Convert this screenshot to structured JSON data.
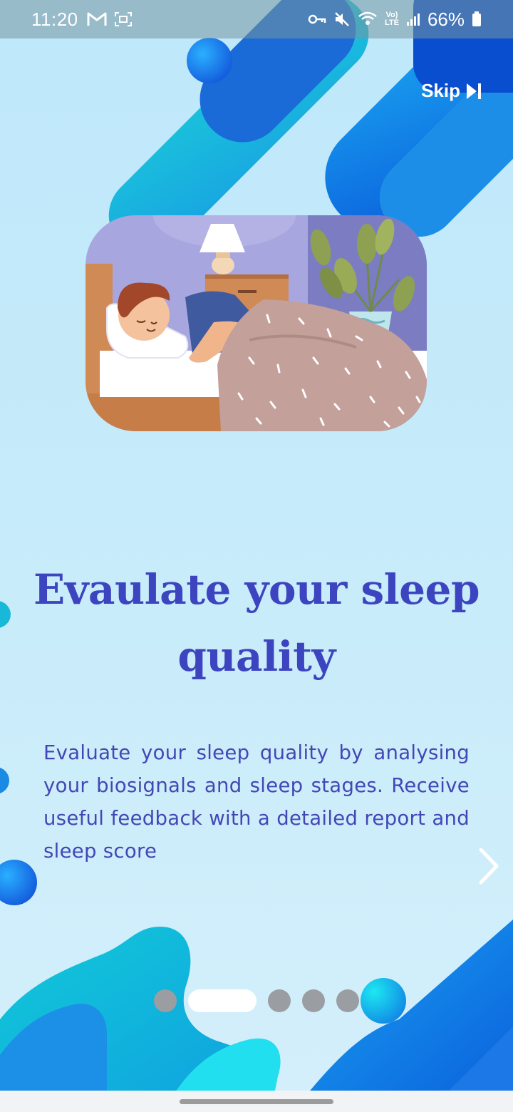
{
  "status_bar": {
    "time": "11:20",
    "battery_text": "66%",
    "left_icons": [
      "gmail-icon",
      "screen-capture-icon"
    ],
    "right_icons": [
      "vpn-key-icon",
      "mute-icon",
      "wifi-icon",
      "volte-icon",
      "signal-icon",
      "battery-icon"
    ],
    "volte_label": "Vo) LTE"
  },
  "onboarding": {
    "skip_label": "Skip",
    "title": "Evaulate your sleep quality",
    "description": "Evaluate your sleep quality by analysing your biosignals and sleep stages. Receive useful feedback with a detailed report and sleep score",
    "page_count": 5,
    "current_page": 2,
    "illustration": "man-sleeping-in-bed"
  },
  "colors": {
    "title": "#3c44c0",
    "description": "#4347b5",
    "accent_blue": "#0a6fe0",
    "accent_cyan": "#19c6e6",
    "dot_inactive": "#9a9ea3",
    "dot_active": "#ffffff"
  }
}
